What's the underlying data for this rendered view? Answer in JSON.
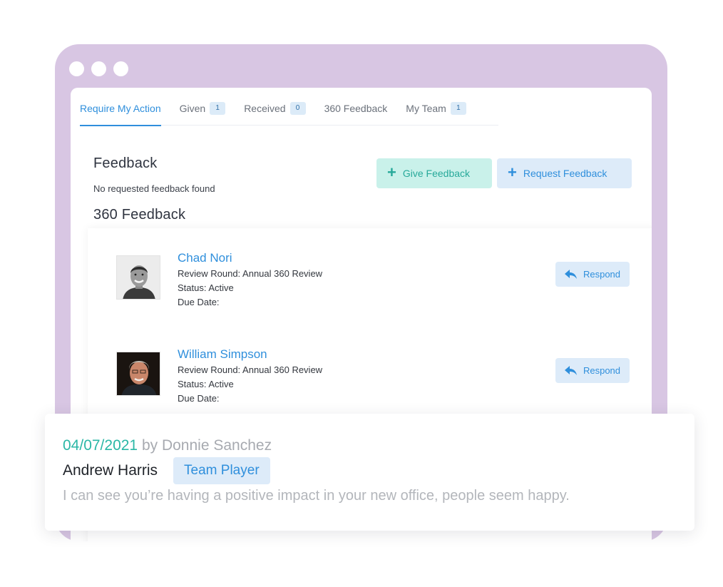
{
  "tabs": [
    {
      "label": "Require My Action",
      "badge": null,
      "active": true
    },
    {
      "label": "Given",
      "badge": "1",
      "active": false
    },
    {
      "label": "Received",
      "badge": "0",
      "active": false
    },
    {
      "label": "360 Feedback",
      "badge": null,
      "active": false
    },
    {
      "label": "My Team",
      "badge": "1",
      "active": false
    }
  ],
  "feedback": {
    "title": "Feedback",
    "empty_message": "No requested feedback found",
    "give_button": "Give Feedback",
    "request_button": "Request Feedback"
  },
  "feedback360": {
    "title": "360 Feedback",
    "people": [
      {
        "name": "Chad Nori",
        "review_round": "Review Round: Annual 360 Review",
        "status": "Status: Active",
        "due_date": "Due Date:",
        "respond_label": "Respond"
      },
      {
        "name": "William Simpson",
        "review_round": "Review Round: Annual 360 Review",
        "status": "Status: Active",
        "due_date": "Due Date:",
        "respond_label": "Respond"
      }
    ]
  },
  "overlay": {
    "date": "04/07/2021",
    "by_text": " by Donnie Sanchez",
    "recipient": "Andrew Harris",
    "tag": "Team Player",
    "comment": "I can see you’re having a positive impact in your new office, people seem happy."
  },
  "colors": {
    "frame": "#d8c6e3",
    "accent_blue": "#2f8fdc",
    "accent_teal": "#27a99a"
  }
}
